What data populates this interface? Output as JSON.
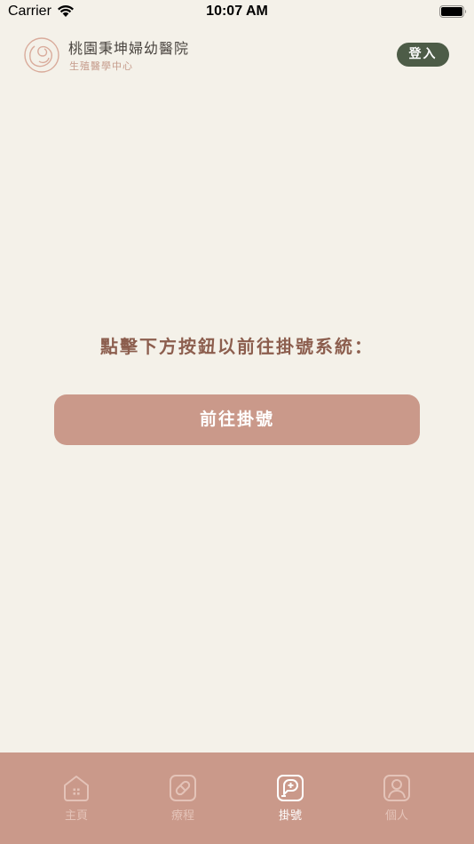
{
  "status_bar": {
    "carrier": "Carrier",
    "time": "10:07 AM"
  },
  "header": {
    "hospital_name": "桃園秉坤婦幼醫院",
    "hospital_subtitle": "生殖醫學中心",
    "login_label": "登入"
  },
  "main": {
    "prompt": "點擊下方按鈕以前往掛號系統：",
    "register_button": "前往掛號"
  },
  "tabs": [
    {
      "label": "主頁",
      "icon": "home-icon",
      "active": false
    },
    {
      "label": "療程",
      "icon": "pill-icon",
      "active": false
    },
    {
      "label": "掛號",
      "icon": "chat-plus-icon",
      "active": true
    },
    {
      "label": "個人",
      "icon": "person-icon",
      "active": false
    }
  ],
  "colors": {
    "background": "#f4f1e9",
    "accent": "#ca998a",
    "login_button": "#4d5c47",
    "prompt_text": "#8c5e4e"
  }
}
